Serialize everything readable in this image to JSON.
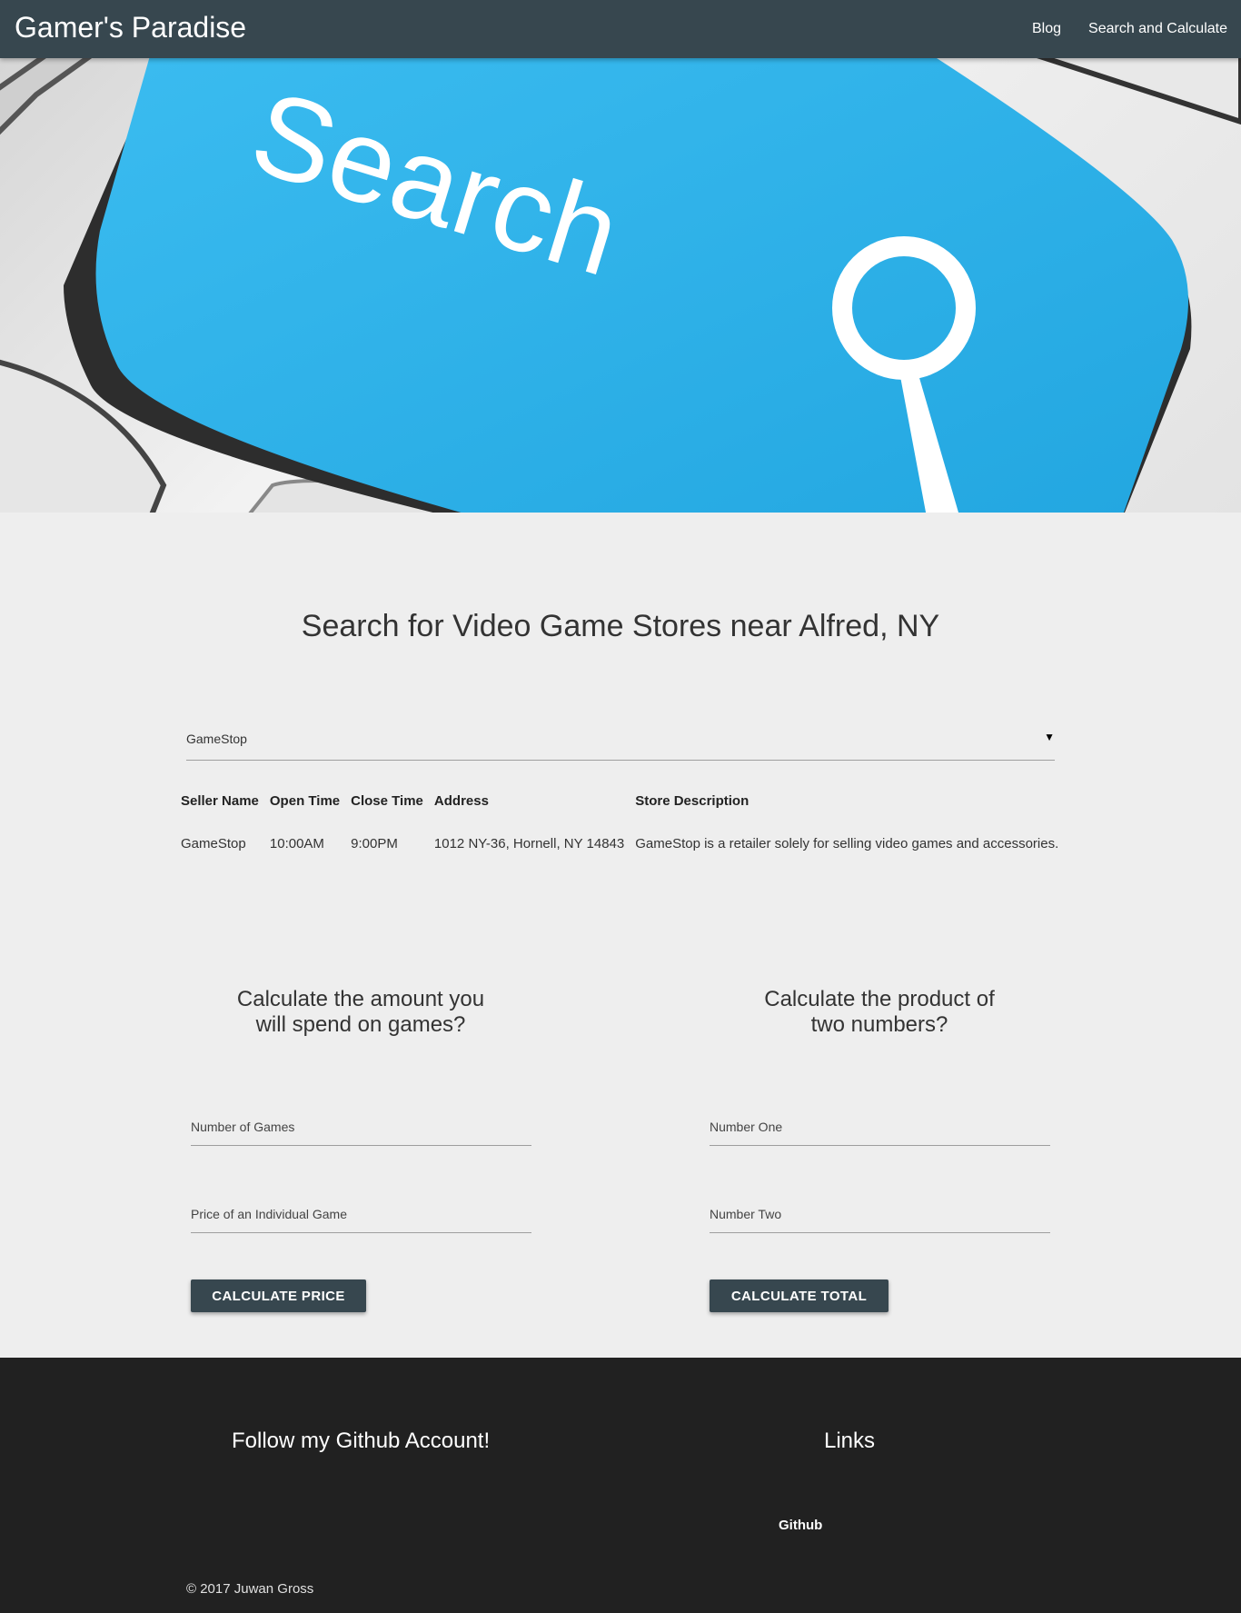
{
  "nav": {
    "brand": "Gamer's Paradise",
    "links": [
      "Blog",
      "Search and Calculate"
    ]
  },
  "hero": {
    "key_text": "Search",
    "key_color": "#2fb2e9"
  },
  "search": {
    "title": "Search for Video Game Stores near Alfred, NY",
    "selected": "GameStop"
  },
  "table": {
    "headers": [
      "Seller Name",
      "Open Time",
      "Close Time",
      "Address",
      "Store Description"
    ],
    "rows": [
      [
        "GameStop",
        "10:00AM",
        "9:00PM",
        "1012 NY-36, Hornell, NY 14843",
        "GameStop is a retailer solely for selling video games and accessories."
      ]
    ]
  },
  "calc_price": {
    "title_line1": "Calculate the amount you",
    "title_line2": "will spend on games?",
    "field1": "Number of Games",
    "field2": "Price of an Individual Game",
    "button": "CALCULATE PRICE"
  },
  "calc_product": {
    "title_line1": "Calculate the product of",
    "title_line2": "two numbers?",
    "field1": "Number One",
    "field2": "Number Two",
    "button": "CALCULATE TOTAL"
  },
  "footer": {
    "github_title": "Follow my Github Account!",
    "links_title": "Links",
    "link": "Github",
    "copyright": "© 2017 Juwan Gross"
  },
  "colors": {
    "nav": "#37474f",
    "footer": "#212121",
    "background": "#eeeeee"
  }
}
